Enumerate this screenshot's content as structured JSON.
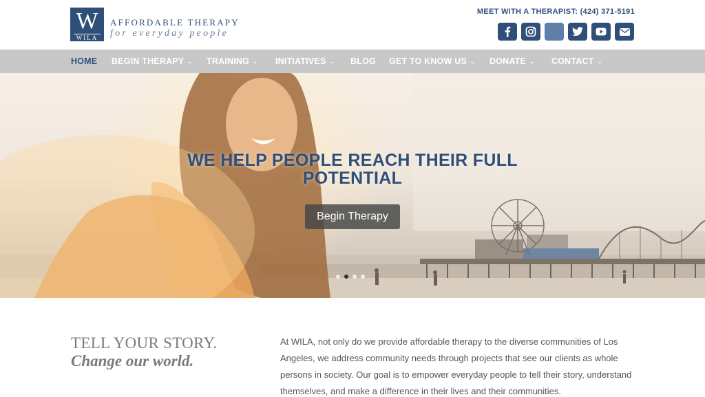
{
  "logo": {
    "mark": "W",
    "sub": "WILA",
    "line1": "AFFORDABLE THERAPY",
    "line2": "for everyday people"
  },
  "header": {
    "meet": "MEET WITH A THERAPIST: (424) 371-5191",
    "socials": [
      "facebook-icon",
      "instagram-icon",
      "blank-icon",
      "twitter-icon",
      "youtube-icon",
      "email-icon"
    ]
  },
  "nav": {
    "home": "HOME",
    "begin_therapy": "BEGIN THERAPY",
    "training": "TRAINING",
    "initiatives": "INITIATIVES",
    "blog": "BLOG",
    "get_to_know_us": "GET TO KNOW US",
    "donate": "DONATE",
    "contact": "CONTACT",
    "chevron": "⌄"
  },
  "hero": {
    "title": "WE HELP PEOPLE REACH THEIR FULL POTENTIAL",
    "button": "Begin Therapy",
    "slides": 4,
    "active_slide": 2
  },
  "story": {
    "heading": "TELL YOUR STORY.",
    "subheading": "Change our world.",
    "body": "At WILA, not only do we provide affordable therapy to the diverse communities of Los Angeles, we address community needs through projects that see our clients as whole persons in society. Our goal is to empower everyday people to tell their story, understand themselves, and make a difference in their lives and their communities."
  },
  "colors": {
    "brand": "#2f4f79",
    "nav_bg": "#c8c8c8",
    "text": "#555555"
  }
}
